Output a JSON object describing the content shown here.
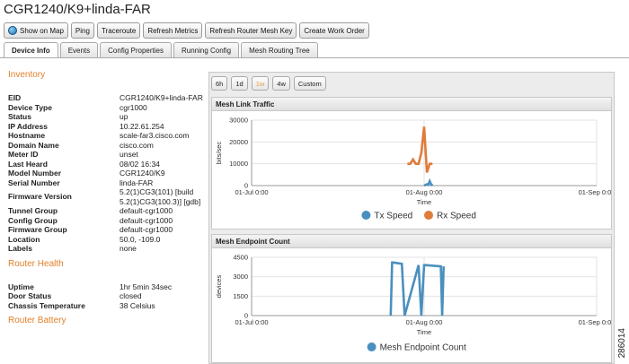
{
  "window": {
    "title": "CGR1240/K9+linda-FAR"
  },
  "toolbar": {
    "buttons": [
      "Show on Map",
      "Ping",
      "Traceroute",
      "Refresh Metrics",
      "Refresh Router Mesh Key",
      "Create Work Order"
    ]
  },
  "tabs": [
    "Device Info",
    "Events",
    "Config Properties",
    "Running Config",
    "Mesh Routing Tree"
  ],
  "active_tab": "Device Info",
  "inventory": {
    "heading": "Inventory",
    "rows": [
      {
        "k": "EID",
        "v": "CGR1240/K9+linda-FAR"
      },
      {
        "k": "Device Type",
        "v": "cgr1000"
      },
      {
        "k": "Status",
        "v": "up"
      },
      {
        "k": "IP Address",
        "v": "10.22.61.254"
      },
      {
        "k": "Hostname",
        "v": "scale-far3.cisco.com"
      },
      {
        "k": "Domain Name",
        "v": "cisco.com"
      },
      {
        "k": "Meter ID",
        "v": "unset"
      },
      {
        "k": "Last Heard",
        "v": "08/02 16:34"
      },
      {
        "k": "Model Number",
        "v": "CGR1240/K9"
      },
      {
        "k": "Serial Number",
        "v": "linda-FAR"
      },
      {
        "k": "Firmware Version",
        "v": "5.2(1)CG3(101) [build 5.2(1)CG3(100.3)] [gdb]"
      },
      {
        "k": "Tunnel Group",
        "v": "default-cgr1000"
      },
      {
        "k": "Config Group",
        "v": "default-cgr1000"
      },
      {
        "k": "Firmware Group",
        "v": "default-cgr1000"
      },
      {
        "k": "Location",
        "v": "50.0, -109.0"
      },
      {
        "k": "Labels",
        "v": "none"
      }
    ]
  },
  "router_health": {
    "heading": "Router Health",
    "rows": [
      {
        "k": "Uptime",
        "v": "1hr 5min 34sec"
      },
      {
        "k": "Door Status",
        "v": "closed"
      },
      {
        "k": "Chassis Temperature",
        "v": "38 Celsius"
      }
    ]
  },
  "router_battery": {
    "heading": "Router Battery"
  },
  "range_buttons": [
    "6h",
    "1d",
    "1w",
    "4w",
    "Custom"
  ],
  "selected_range": "1w",
  "figure_number": "286014",
  "chart_data": [
    {
      "type": "line",
      "title": "Mesh Link Traffic",
      "ylabel": "bits/sec",
      "xlabel": "Time",
      "ylim": [
        0,
        30000
      ],
      "yticks": [
        0,
        10000,
        20000,
        30000
      ],
      "xticks": [
        "01-Jul 0:00",
        "01-Aug 0:00",
        "01-Sep 0:00"
      ],
      "grid": true,
      "legend_position": "bottom",
      "series": [
        {
          "name": "Tx Speed",
          "color": "#4a8fbf",
          "x": [
            "01-Aug 0:00",
            "01-Aug 6:00",
            "01-Aug 12:00",
            "01-Aug 18:00",
            "02-Aug 0:00",
            "02-Aug 6:00",
            "02-Aug 12:00"
          ],
          "values": [
            0,
            300,
            600,
            400,
            2000,
            600,
            0
          ]
        },
        {
          "name": "Rx Speed",
          "color": "#e07b39",
          "x": [
            "29-Jul 0:00",
            "29-Jul 12:00",
            "30-Jul 0:00",
            "30-Jul 12:00",
            "31-Jul 0:00",
            "31-Jul 12:00",
            "01-Aug 0:00",
            "01-Aug 12:00",
            "02-Aug 0:00",
            "02-Aug 12:00"
          ],
          "values": [
            10000,
            10000,
            12000,
            10000,
            10000,
            15000,
            27000,
            6000,
            10000,
            10000
          ]
        }
      ]
    },
    {
      "type": "line",
      "title": "Mesh Endpoint Count",
      "ylabel": "devices",
      "xlabel": "Time",
      "ylim": [
        0,
        4500
      ],
      "yticks": [
        0,
        1500,
        3000,
        4500
      ],
      "xticks": [
        "01-Jul 0:00",
        "01-Aug 0:00",
        "01-Sep 0:00"
      ],
      "grid": true,
      "legend_position": "bottom",
      "series": [
        {
          "name": "Mesh Endpoint Count",
          "color": "#4a8fbf",
          "x": [
            "26-Jul 0:00",
            "26-Jul 6:00",
            "26-Jul 12:00",
            "28-Jul 0:00",
            "28-Jul 12:00",
            "31-Jul 0:00",
            "31-Jul 12:00",
            "01-Aug 0:00",
            "01-Aug 6:00",
            "04-Aug 0:00",
            "04-Aug 6:00",
            "04-Aug 12:00"
          ],
          "values": [
            0,
            4100,
            4100,
            4000,
            0,
            3900,
            0,
            3900,
            3900,
            3800,
            0,
            3800
          ]
        }
      ]
    }
  ]
}
